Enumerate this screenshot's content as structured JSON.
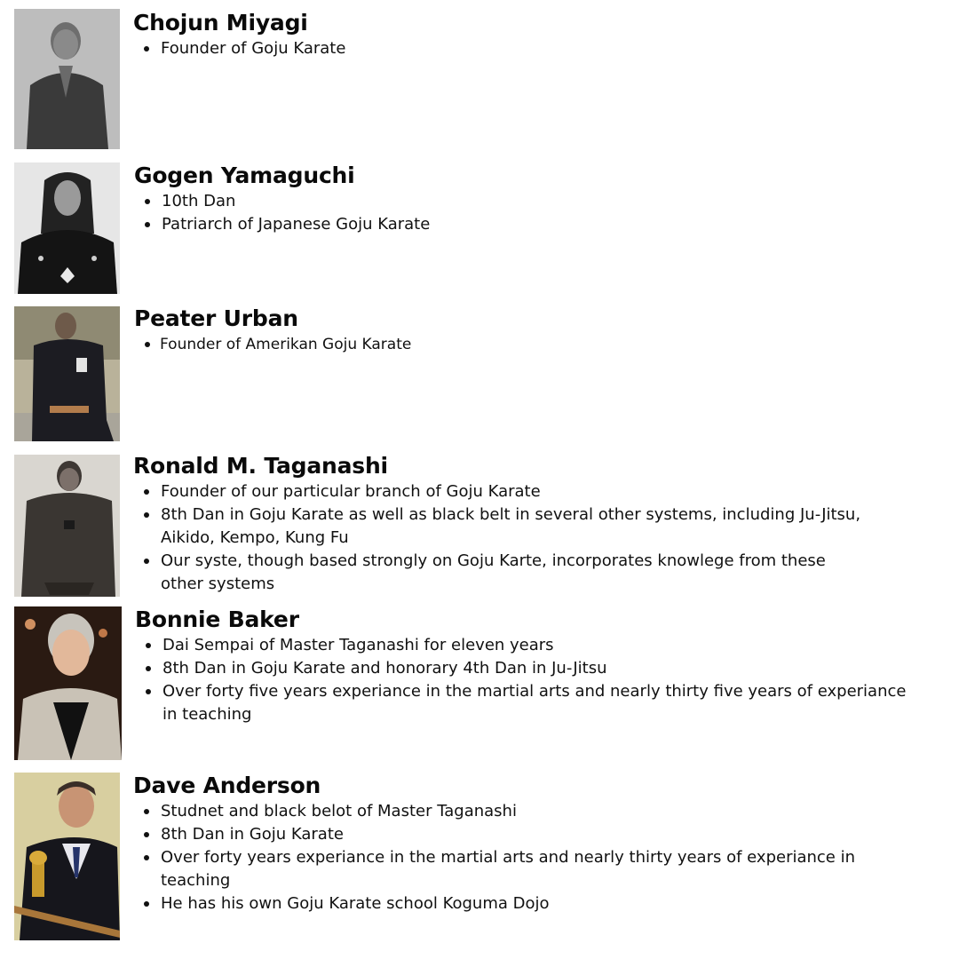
{
  "people": [
    {
      "name": "Chojun Miyagi",
      "photo_description": "black-and-white portrait",
      "bullets": [
        "Founder of Goju Karate"
      ]
    },
    {
      "name": "Gogen Yamaguchi",
      "photo_description": "black-and-white portrait in kimono",
      "bullets": [
        "10th Dan",
        "Patriarch of Japanese Goju Karate"
      ]
    },
    {
      "name": "Peater Urban",
      "photo_description": "seated man in black gi outdoors",
      "bullets": [
        "Founder of Amerikan Goju Karate"
      ]
    },
    {
      "name": "Ronald M. Taganashi",
      "photo_description": "black-and-white photo in gi",
      "bullets": [
        "Founder of our particular branch of Goju Karate",
        "8th Dan in Goju Karate as well as black belt in several other systems, including Ju-Jitsu, Aikido, Kempo, Kung Fu",
        "Our syste, though based strongly on Goju Karte, incorporates knowlege from these other systems"
      ]
    },
    {
      "name": "Bonnie Baker",
      "photo_description": "color portrait of woman with short hair",
      "bullets": [
        "Dai Sempai of Master Taganashi for eleven years",
        "8th Dan in Goju Karate and honorary 4th Dan in Ju-Jitsu",
        "Over forty five years experiance in the martial arts and nearly thirty five years of experiance in teaching"
      ]
    },
    {
      "name": "Dave Anderson",
      "photo_description": "color photo of man in suit holding trophy",
      "bullets": [
        "Studnet and black belot of Master Taganashi",
        "8th Dan in Goju Karate",
        "Over forty years experiance in the martial arts and nearly thirty years of experiance in teaching",
        "He has his own Goju Karate school Koguma Dojo"
      ]
    }
  ]
}
